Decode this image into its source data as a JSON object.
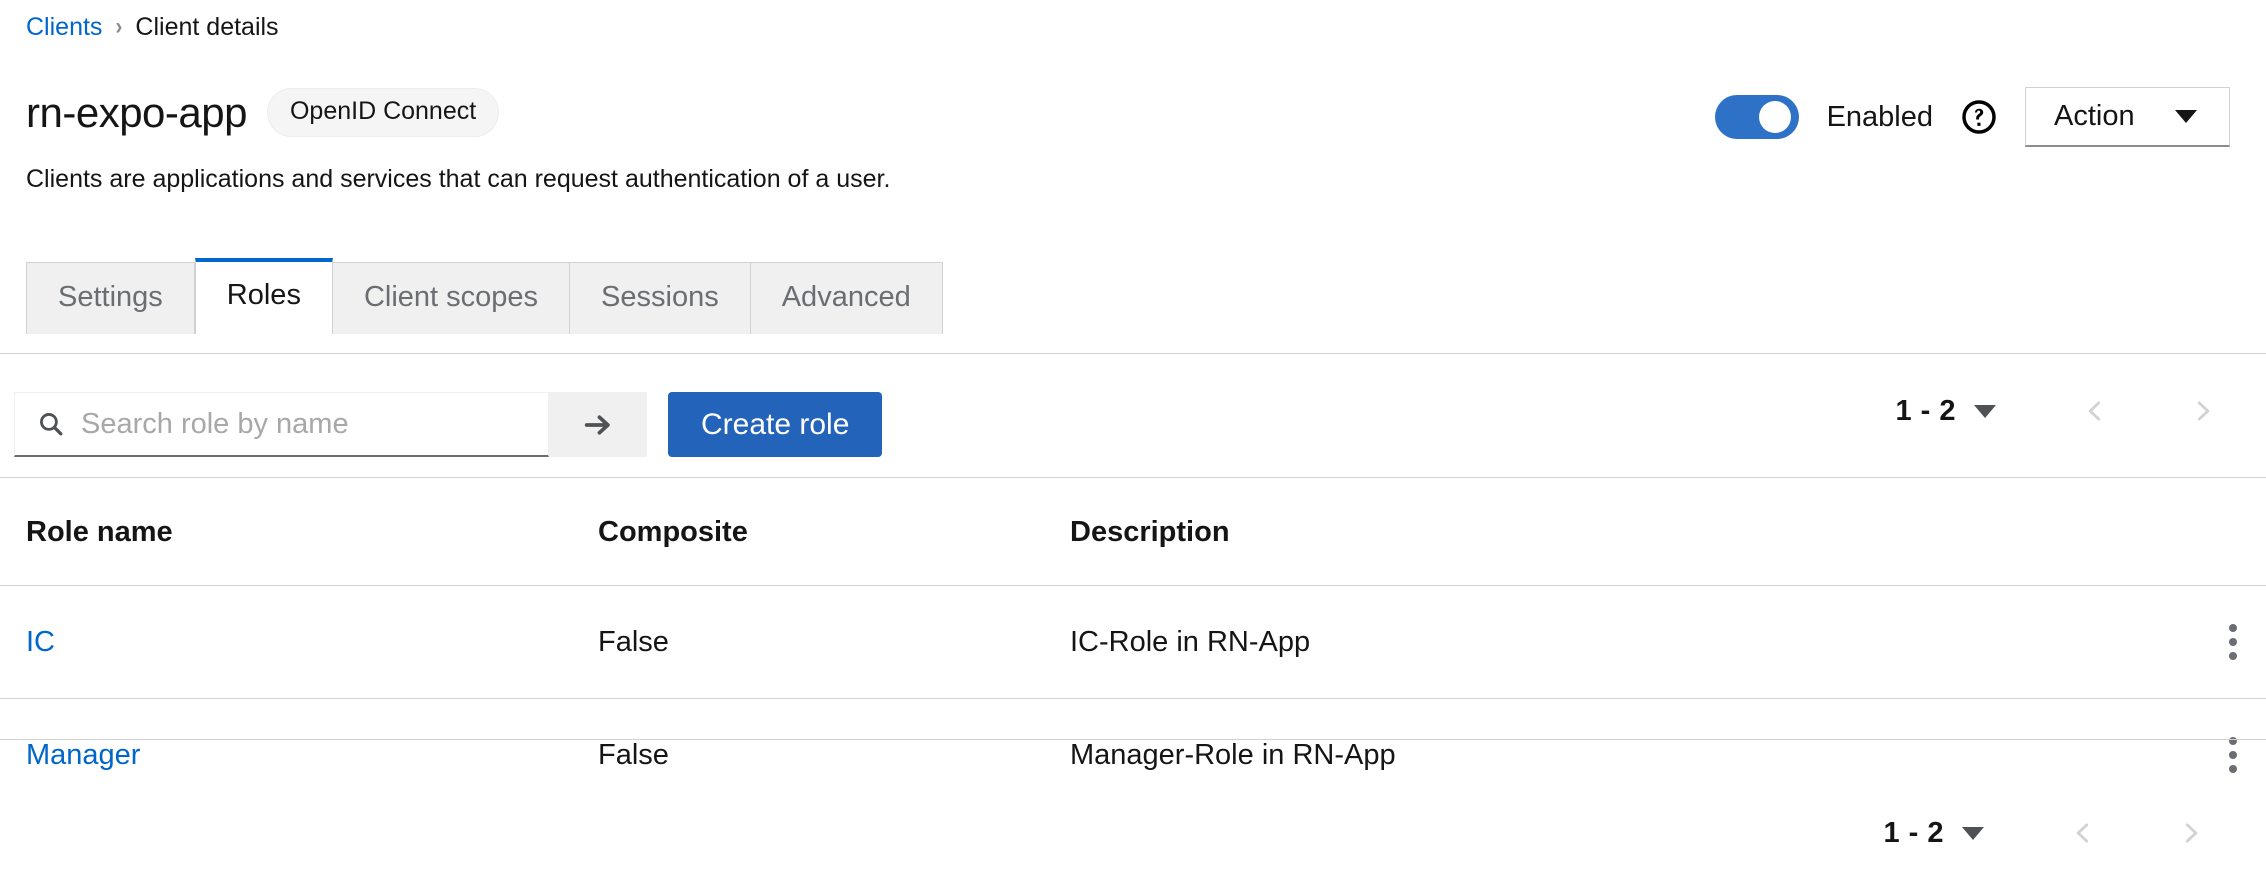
{
  "breadcrumb": {
    "parent": "Clients",
    "separator": "›",
    "current": "Client details"
  },
  "header": {
    "title": "rn-expo-app",
    "protocol_badge": "OpenID Connect",
    "subtitle": "Clients are applications and services that can request authentication of a user.",
    "enabled_label": "Enabled",
    "enabled_state": "on",
    "help_icon": "help-circle-icon",
    "action_button": "Action",
    "action_caret": "chevron-down-icon",
    "toggle_color": "#2e72c8"
  },
  "tabs": [
    {
      "label": "Settings",
      "active": false
    },
    {
      "label": "Roles",
      "active": true
    },
    {
      "label": "Client scopes",
      "active": false
    },
    {
      "label": "Sessions",
      "active": false
    },
    {
      "label": "Advanced",
      "active": false
    }
  ],
  "toolbar": {
    "search_icon": "search-icon",
    "search_value": "",
    "search_placeholder": "Search role by name",
    "search_submit_icon": "arrow-right-icon",
    "create_label": "Create role",
    "create_color": "#2463ba"
  },
  "pagination": {
    "range": "1 - 2",
    "caret_icon": "caret-down-icon",
    "prev_icon": "chevron-left-icon",
    "next_icon": "chevron-right-icon",
    "prev_disabled": true,
    "next_disabled": true
  },
  "table": {
    "columns": [
      "Role name",
      "Composite",
      "Description"
    ],
    "rows": [
      {
        "name": "IC",
        "composite": "False",
        "description": "IC-Role in RN-App",
        "kebab": "kebab-menu-icon"
      },
      {
        "name": "Manager",
        "composite": "False",
        "description": "Manager-Role in RN-App",
        "kebab": "kebab-menu-icon"
      }
    ]
  }
}
